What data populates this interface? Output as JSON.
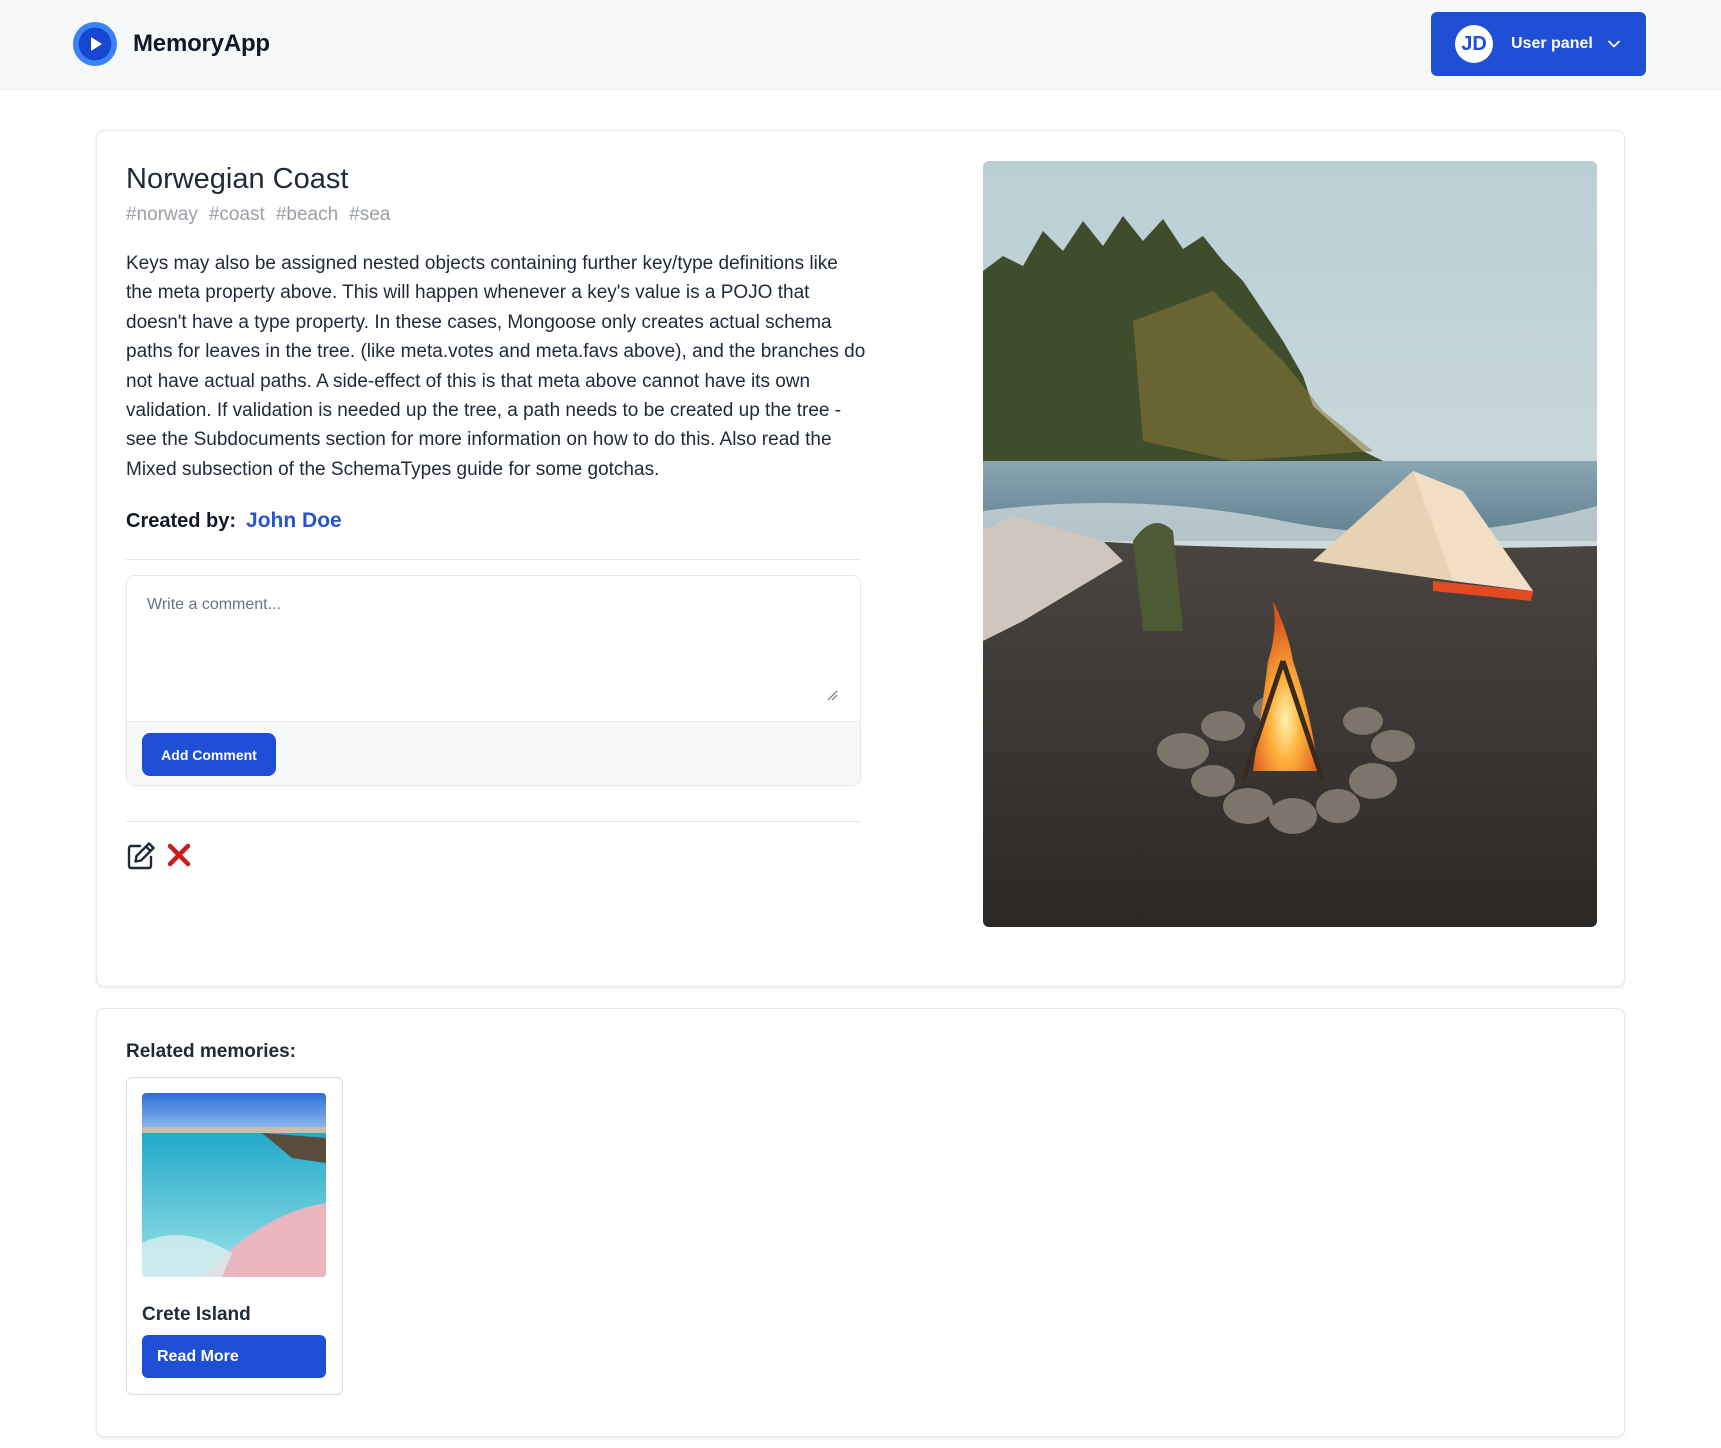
{
  "header": {
    "app_name": "MemoryApp",
    "logo_icon": "play-circle-icon",
    "user_panel": {
      "initials": "JD",
      "label": "User panel",
      "chevron_icon": "chevron-down-icon"
    }
  },
  "memory": {
    "title": "Norwegian Coast",
    "tags": [
      "#norway",
      "#coast",
      "#beach",
      "#sea"
    ],
    "description": "Keys may also be assigned nested objects containing further key/type definitions like the meta property above. This will happen whenever a key's value is a POJO that doesn't have a type property. In these cases, Mongoose only creates actual schema paths for leaves in the tree. (like meta.votes and meta.favs above), and the branches do not have actual paths. A side-effect of this is that meta above cannot have its own validation. If validation is needed up the tree, a path needs to be created up the tree - see the Subdocuments section for more information on how to do this. Also read the Mixed subsection of the SchemaTypes guide for some gotchas.",
    "created_by_label": "Created by:",
    "created_by_name": "John Doe",
    "image_alt": "campfire on beach with tent"
  },
  "comment": {
    "placeholder": "Write a comment...",
    "value": "",
    "submit_label": "Add Comment"
  },
  "actions": {
    "edit_icon": "edit-icon",
    "delete_icon": "close-icon"
  },
  "related": {
    "heading": "Related memories:",
    "items": [
      {
        "name": "Crete Island",
        "button_label": "Read More",
        "image_alt": "turquoise beach with pink sand"
      }
    ]
  },
  "colors": {
    "primary": "#1e4fd6",
    "link": "#2555c9",
    "danger": "#c81e1e",
    "tag": "#9aa0a6"
  }
}
